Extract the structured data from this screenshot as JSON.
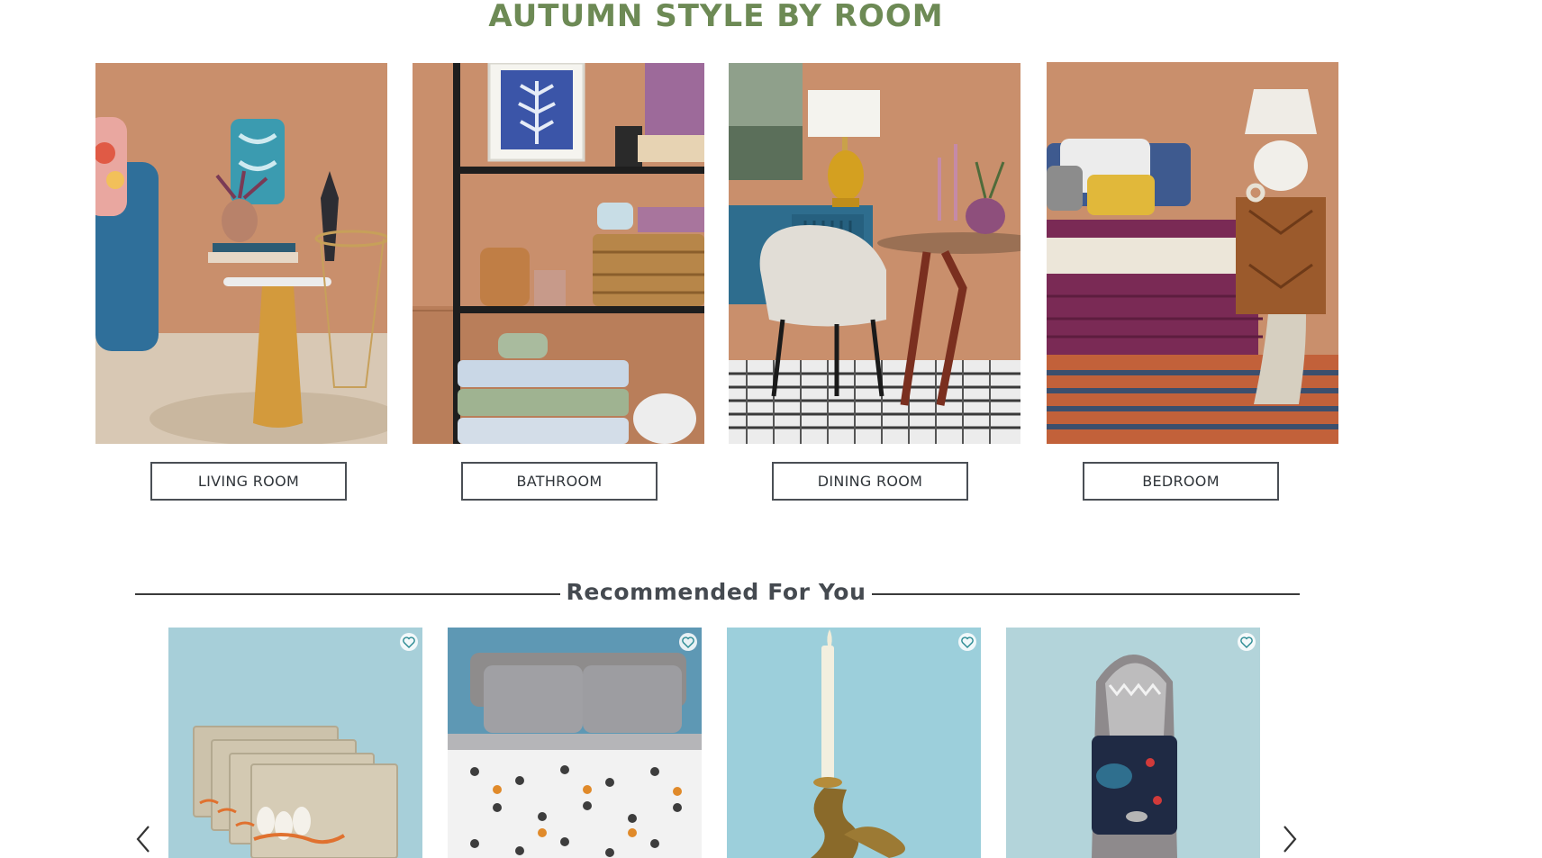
{
  "section": {
    "title": "AUTUMN STYLE BY ROOM"
  },
  "rooms": [
    {
      "label": "LIVING ROOM"
    },
    {
      "label": "BATHROOM"
    },
    {
      "label": "DINING ROOM"
    },
    {
      "label": "BEDROOM"
    }
  ],
  "recommended": {
    "title": "Recommended For You",
    "prev_icon": "chevron-left-icon",
    "next_icon": "chevron-right-icon",
    "products": [
      {
        "icon": "heart-icon"
      },
      {
        "icon": "heart-icon"
      },
      {
        "icon": "heart-icon"
      },
      {
        "icon": "heart-icon"
      }
    ]
  },
  "colors": {
    "title_green": "#6d8a55",
    "button_border": "#4a4f55",
    "product_bg": "#a6ced8",
    "wall_terracotta": "#c98f6c"
  }
}
